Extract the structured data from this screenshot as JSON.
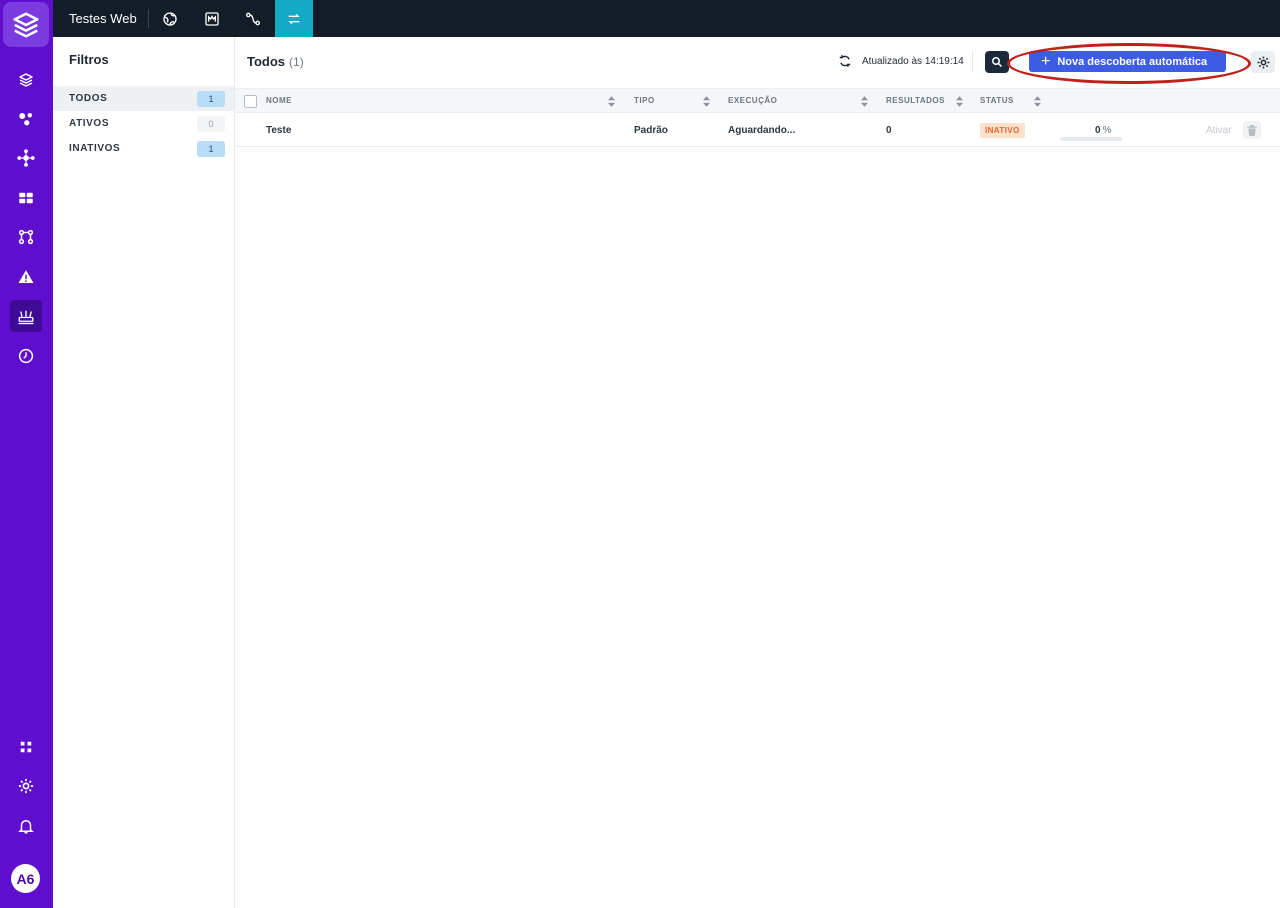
{
  "topbar": {
    "title": "Testes Web",
    "buttons": [
      "globe-icon",
      "monitor-icon",
      "route-icon",
      "transfer-icon"
    ],
    "active": "transfer-icon"
  },
  "rail": {
    "items": [
      "layers-icon",
      "graph-icon",
      "network-icon",
      "dashboard-icon",
      "flow-icon",
      "warning-icon",
      "router-icon",
      "clock-icon"
    ],
    "bottom": [
      "apps-icon",
      "gear-icon",
      "bell-icon"
    ],
    "active": "router-icon",
    "avatar": "A6"
  },
  "filters": {
    "title": "Filtros",
    "items": [
      {
        "label": "TODOS",
        "count": "1",
        "selected": true
      },
      {
        "label": "ATIVOS",
        "count": "0",
        "selected": false
      },
      {
        "label": "INATIVOS",
        "count": "1",
        "selected": false
      }
    ]
  },
  "main": {
    "title": "Todos",
    "count": "(1)",
    "updated": "Atualizado às 14:19:14",
    "new_button": "Nova descoberta automática"
  },
  "table": {
    "columns": [
      "NOME",
      "TIPO",
      "EXECUÇÃO",
      "RESULTADOS",
      "STATUS"
    ],
    "rows": [
      {
        "nome": "Teste",
        "tipo": "Padrão",
        "execucao": "Aguardando...",
        "resultados": "0",
        "status": "INATIVO",
        "progress": "0",
        "progress_unit": "%",
        "action": "Ativar"
      }
    ]
  },
  "colors": {
    "rail": "#5e0ecc",
    "topbar": "#131d27",
    "accent": "#3d5ce6",
    "active_tab": "#14a9c4",
    "status_inactive": "#e0662a",
    "highlight": "#c0201a"
  }
}
